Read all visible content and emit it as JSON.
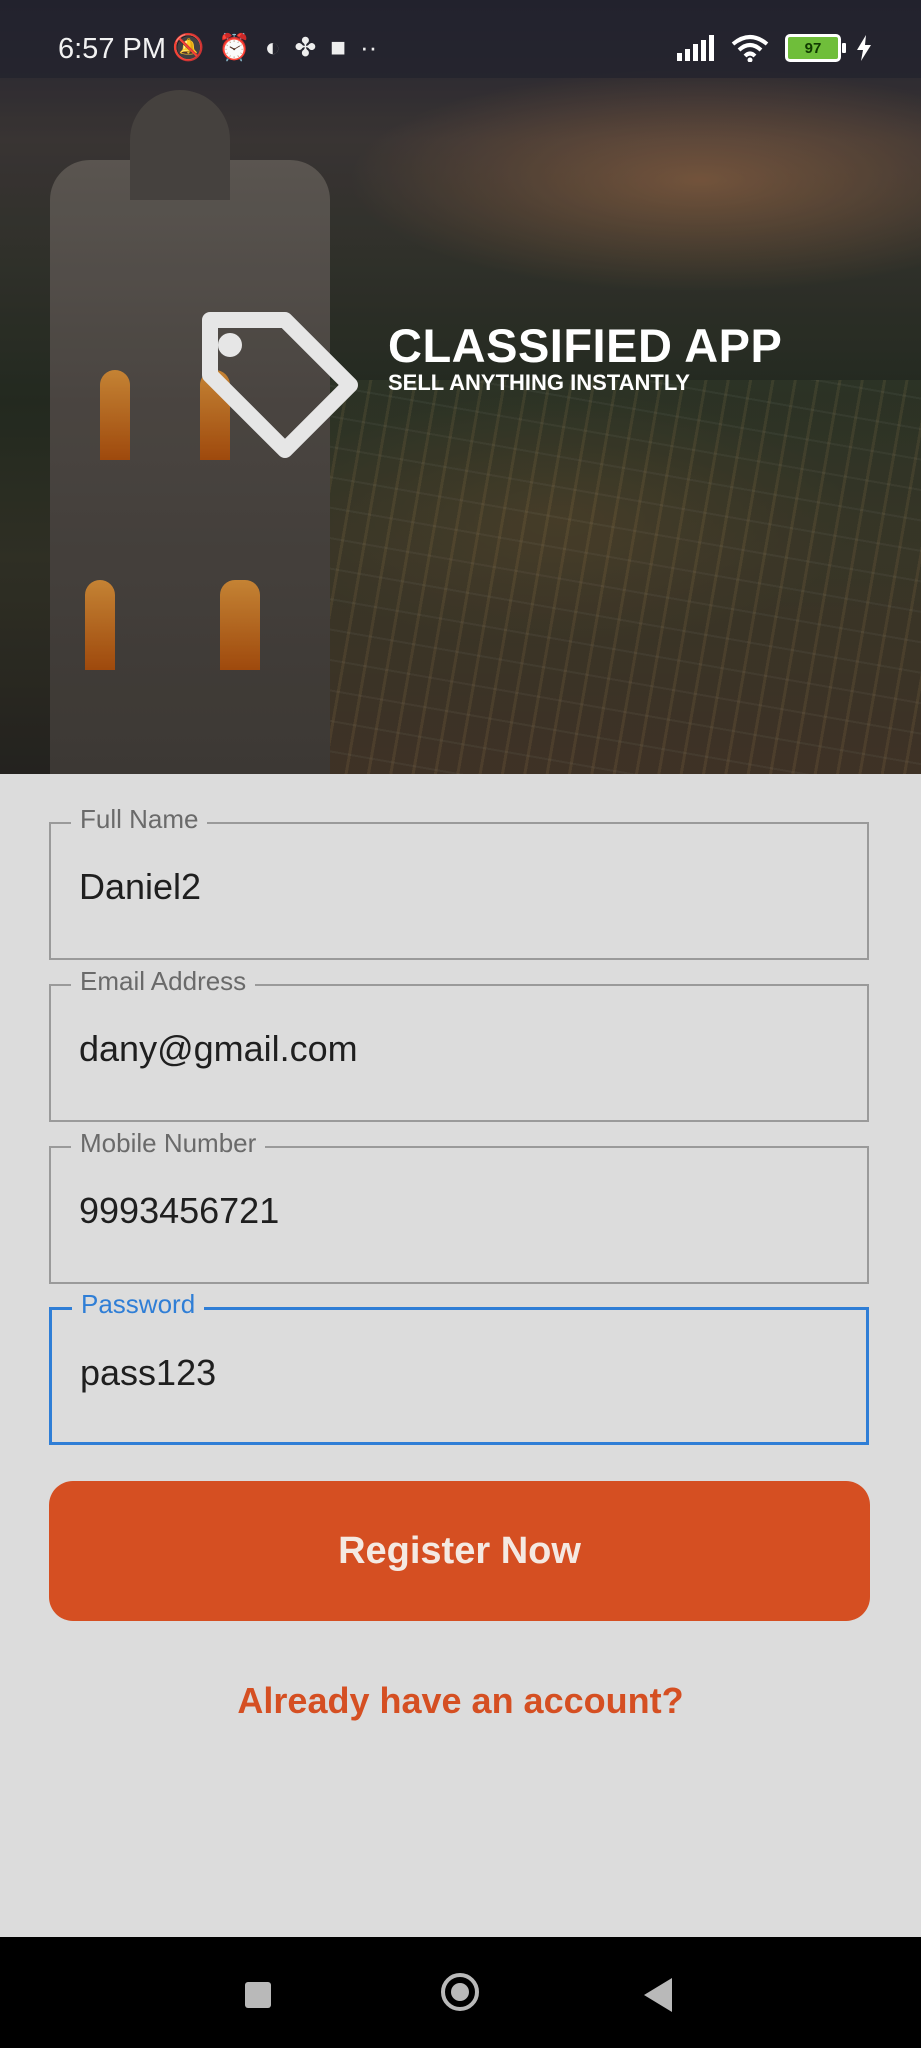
{
  "status_bar": {
    "time": "6:57 PM",
    "battery_level": "97",
    "icons": [
      "mute-icon",
      "alarm-icon",
      "app-notification-icon",
      "fan-icon",
      "video-icon",
      "more-dots-icon",
      "signal-icon",
      "wifi-icon",
      "battery-icon",
      "charging-icon"
    ]
  },
  "hero": {
    "title": "CLASSIFIED APP",
    "subtitle": "SELL ANYTHING INSTANTLY",
    "logo_icon": "price-tag-icon"
  },
  "form": {
    "fields": [
      {
        "label": "Full Name",
        "value": "Daniel2"
      },
      {
        "label": "Email Address",
        "value": "dany@gmail.com"
      },
      {
        "label": "Mobile Number",
        "value": "9993456721"
      },
      {
        "label": "Password",
        "value": "pass123",
        "focused": true
      }
    ],
    "submit_label": "Register Now",
    "login_link": "Already have an account?"
  },
  "colors": {
    "accent": "#d54f22",
    "focus": "#2f7ed6",
    "background": "#dcdcdc"
  },
  "nav_bar": {
    "buttons": [
      "recents-square-icon",
      "home-circle-icon",
      "back-triangle-icon"
    ]
  }
}
